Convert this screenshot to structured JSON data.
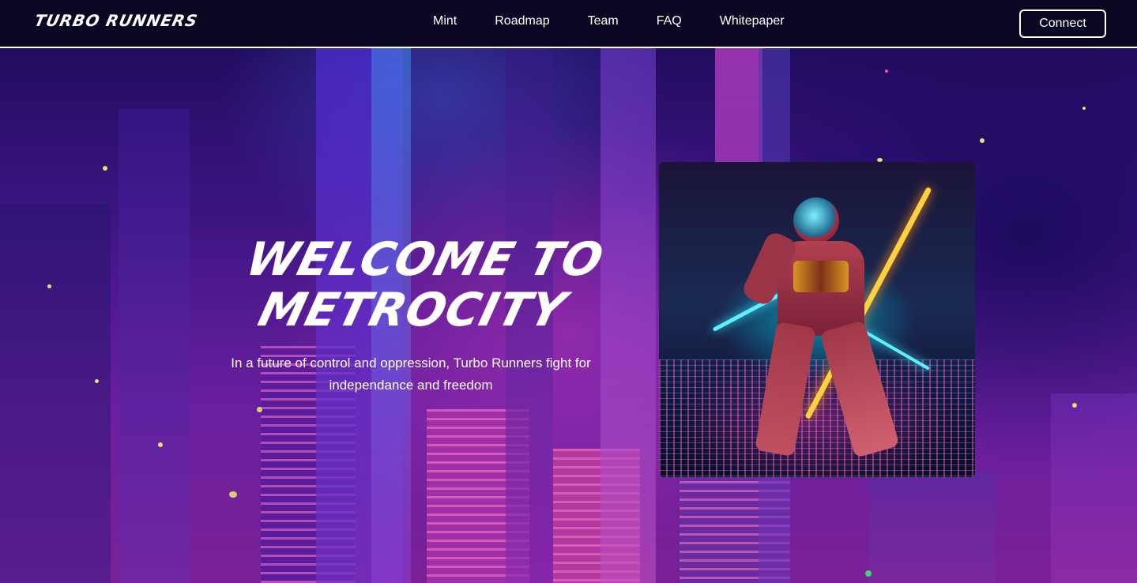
{
  "navbar": {
    "logo": "TURBO RUNNERS",
    "links": [
      {
        "label": "Mint"
      },
      {
        "label": "Roadmap"
      },
      {
        "label": "Team"
      },
      {
        "label": "FAQ"
      },
      {
        "label": "Whitepaper"
      }
    ],
    "connect_label": "Connect"
  },
  "hero": {
    "title_line1": "WELCOME TO",
    "title_line2": "METROCITY",
    "subtitle_line1": "In a future of control and oppression, Turbo Runners fight for",
    "subtitle_line2": "independance and freedom"
  },
  "colors": {
    "navbar_bg": "#0b0722",
    "background_top": "#1a0a55",
    "background_bottom": "#7a2096",
    "neon_pink": "#ff5fc8",
    "neon_cyan": "#3fe6ff",
    "neon_orange": "#ffb020"
  }
}
